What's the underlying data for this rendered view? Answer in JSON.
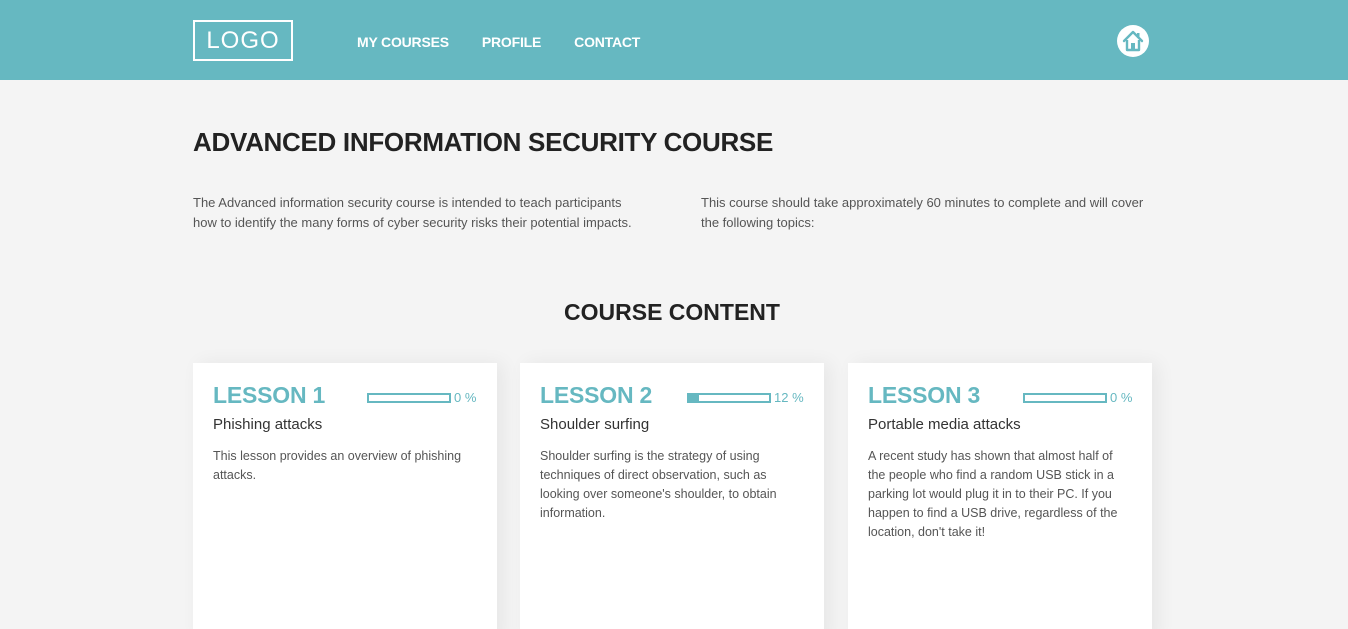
{
  "header": {
    "logo": "LOGO",
    "nav": [
      "MY COURSES",
      "PROFILE",
      "CONTACT"
    ],
    "home_icon": "home-icon",
    "bg_color": "#66b8c1"
  },
  "course": {
    "title": "ADVANCED INFORMATION SECURITY COURSE",
    "intro_left": "The Advanced information security course is intended to teach participants how to identify the many forms of cyber security risks their potential impacts.",
    "intro_right": "This course should take approximately 60 minutes to complete and will cover the following topics:"
  },
  "content": {
    "title": "COURSE CONTENT",
    "lessons": [
      {
        "title": "LESSON 1",
        "progress": 0,
        "progress_label": "0 %",
        "subtitle": "Phishing attacks",
        "description": "This lesson provides an overview of phishing attacks."
      },
      {
        "title": "LESSON 2",
        "progress": 12,
        "progress_label": "12 %",
        "subtitle": "Shoulder surfing",
        "description": "Shoulder surfing is the strategy of using techniques of direct observation, such as looking over someone's shoulder, to obtain information."
      },
      {
        "title": "LESSON 3",
        "progress": 0,
        "progress_label": "0 %",
        "subtitle": "Portable media attacks",
        "description": "A recent study has shown that almost half of the people who find a random USB stick in a parking lot would plug it in to their PC. If you happen to find a USB drive, regardless of the location, don't take it!"
      }
    ]
  }
}
